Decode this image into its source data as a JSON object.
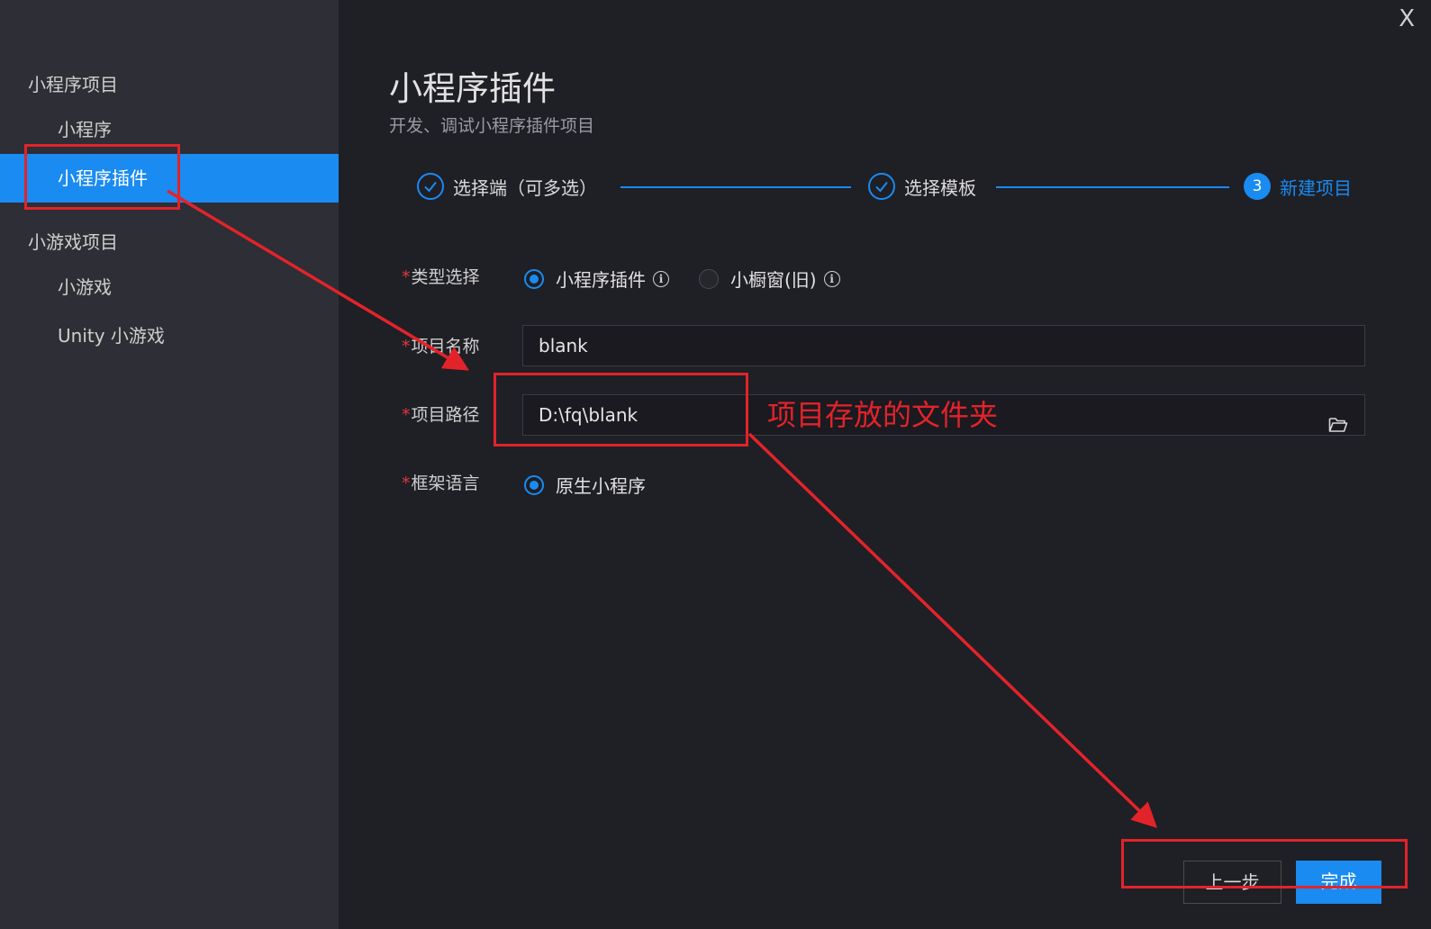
{
  "sidebar": {
    "groups": [
      {
        "title": "小程序项目",
        "items": [
          "小程序",
          "小程序插件"
        ]
      },
      {
        "title": "小游戏项目",
        "items": [
          "小游戏",
          "Unity 小游戏"
        ]
      }
    ],
    "active_item": "小程序插件"
  },
  "window": {
    "close_label": "X"
  },
  "header": {
    "title": "小程序插件",
    "subtitle": "开发、调试小程序插件项目"
  },
  "steps": [
    {
      "label": "选择端（可多选）",
      "state": "done"
    },
    {
      "label": "选择模板",
      "state": "done"
    },
    {
      "number": "3",
      "label": "新建项目",
      "state": "current"
    }
  ],
  "form": {
    "required_mark": "*",
    "type": {
      "label": "类型选择",
      "options": [
        {
          "label": "小程序插件",
          "selected": true
        },
        {
          "label": "小橱窗(旧)",
          "selected": false
        }
      ],
      "info_glyph": "i"
    },
    "name": {
      "label": "项目名称",
      "value": "blank"
    },
    "path": {
      "label": "项目路径",
      "value": "D:\\fq\\blank"
    },
    "framework": {
      "label": "框架语言",
      "options": [
        {
          "label": "原生小程序",
          "selected": true
        }
      ]
    }
  },
  "footer": {
    "prev_label": "上一步",
    "done_label": "完成"
  },
  "annotations": {
    "path_note": "项目存放的文件夹",
    "color": "#e3232a"
  },
  "colors": {
    "accent": "#1a8bf0",
    "sidebar_bg": "#2e2e36",
    "main_bg": "#1f1f26"
  }
}
